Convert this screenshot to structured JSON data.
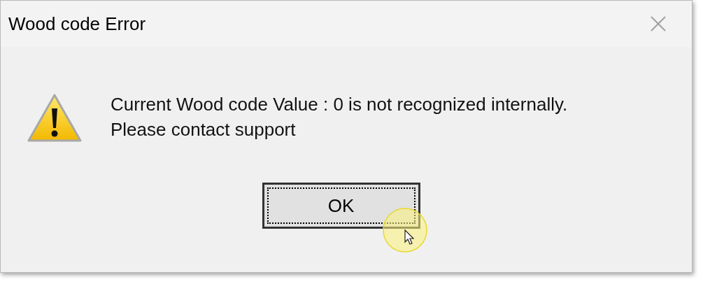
{
  "window": {
    "title": "Wood code Error"
  },
  "message": [
    "Current Wood code Value : 0 is not recognized internally.",
    "Please contact support"
  ],
  "buttons": [
    {
      "label": "OK",
      "focused": true
    }
  ]
}
